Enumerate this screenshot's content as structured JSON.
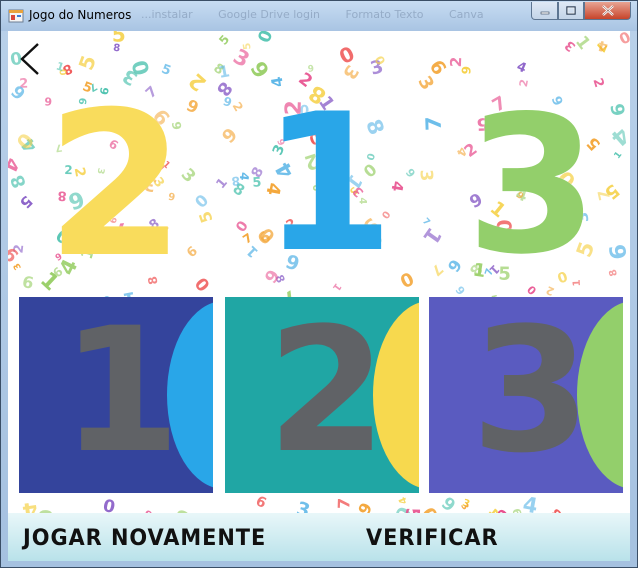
{
  "window": {
    "title": "Jogo do Numeros",
    "icon": "app-form-icon",
    "controls": [
      "minimize-icon",
      "maximize-icon",
      "close-icon"
    ]
  },
  "background_tabs": [
    "...instalar",
    "Google Drive login",
    "Formato Texto",
    "Canva"
  ],
  "navigation": {
    "back_icon": "chevron-left-icon"
  },
  "target_sequence": [
    {
      "digit": "2",
      "color": "#f9dc5c"
    },
    {
      "digit": "1",
      "color": "#29a6e8"
    },
    {
      "digit": "3",
      "color": "#93cf6b"
    }
  ],
  "tiles": [
    {
      "digit": "1",
      "bg_color": "#34449c",
      "accent_color": "#29a6e8"
    },
    {
      "digit": "2",
      "bg_color": "#20a6a4",
      "accent_color": "#f7d94e"
    },
    {
      "digit": "3",
      "bg_color": "#5a5bc0",
      "accent_color": "#93cf6b"
    }
  ],
  "actions": {
    "play_again": "JOGAR NOVAMENTE",
    "verify": "VERIFICAR"
  }
}
